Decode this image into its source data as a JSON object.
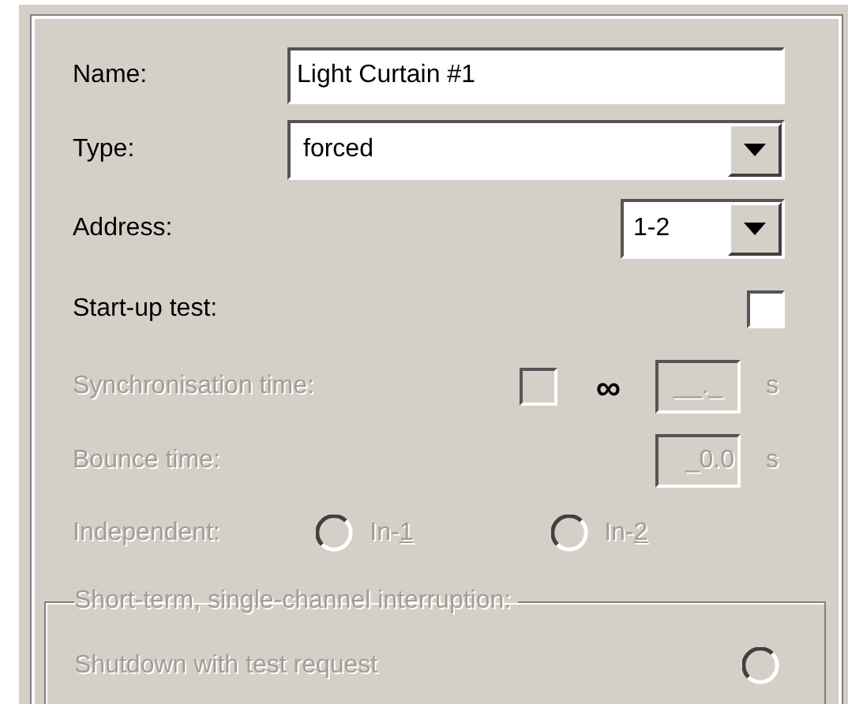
{
  "fields": [
    {
      "kind": "text",
      "label": "Name:",
      "value": "Light Curtain #1"
    },
    {
      "kind": "combo",
      "label": "Type:",
      "value": "forced"
    },
    {
      "kind": "short_combo",
      "label": "Address:",
      "value": "1-2"
    }
  ],
  "startup_test": {
    "label": "Start-up test:",
    "checked": false
  },
  "sync_time": {
    "label": "Synchronisation time:",
    "disabled": true,
    "infinite_checked": false,
    "infinite_symbol": "∞",
    "value": "__._",
    "unit": "s"
  },
  "bounce_time": {
    "label": "Bounce time:",
    "disabled": true,
    "value": "_0.0",
    "unit": "s"
  },
  "independent": {
    "label": "Independent:",
    "disabled": true,
    "options": [
      {
        "prefix": "In-",
        "access_key": "1",
        "selected": false
      },
      {
        "prefix": "In-",
        "access_key": "2",
        "selected": false
      }
    ]
  },
  "interruption": {
    "title": "Short-term, single-channel interruption:",
    "disabled": true,
    "items": [
      {
        "label": "Shutdown with test request",
        "selected": false
      }
    ]
  }
}
